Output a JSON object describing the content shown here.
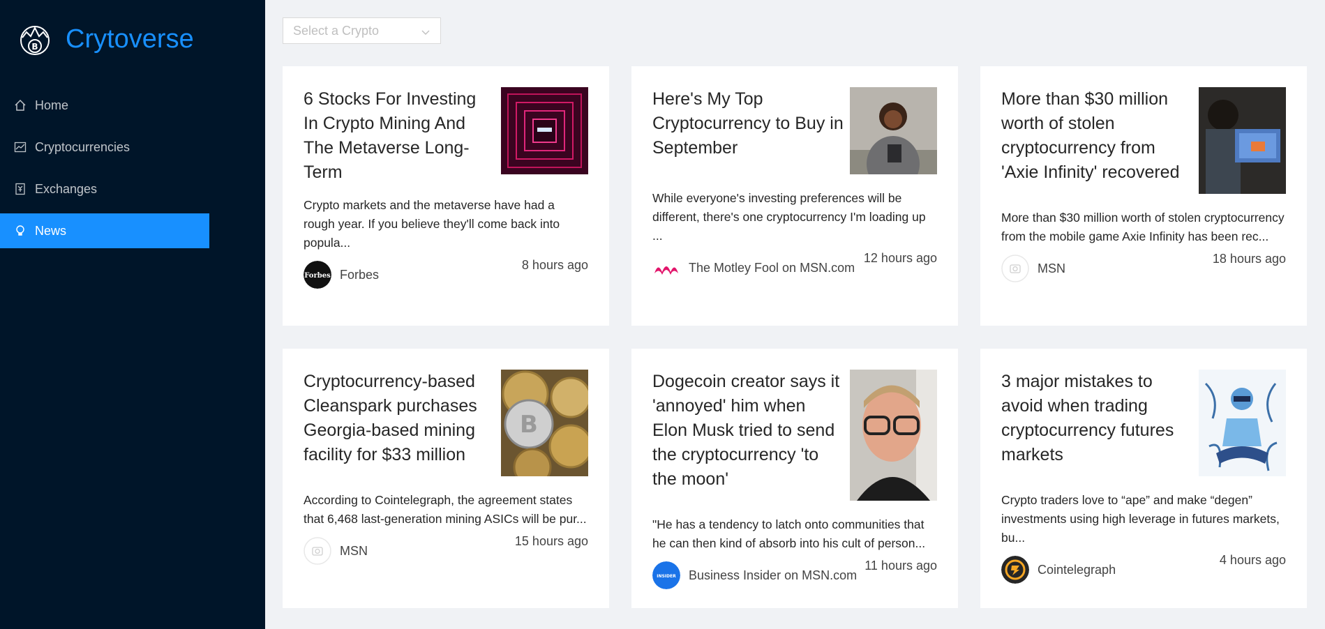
{
  "app": {
    "name": "Crytoverse"
  },
  "colors": {
    "sidebar_bg": "#001529",
    "accent": "#1890ff",
    "page_bg": "#f0f2f5"
  },
  "menu": [
    {
      "label": "Home",
      "icon": "home-icon"
    },
    {
      "label": "Cryptocurrencies",
      "icon": "fund-icon"
    },
    {
      "label": "Exchanges",
      "icon": "money-collect-icon"
    },
    {
      "label": "News",
      "icon": "bulb-icon",
      "active": true
    }
  ],
  "select": {
    "placeholder": "Select a Crypto"
  },
  "news": [
    {
      "title": "6 Stocks For Investing In Crypto Mining And The Metaverse Long-Term",
      "description": "Crypto markets and the metaverse have had a rough year. If you believe they'll come back into popula...",
      "provider": "Forbes",
      "time": "8 hours ago",
      "thumb": "neon-tunnel-image",
      "avatar": "forbes-logo"
    },
    {
      "title": "Here's My Top Cryptocurrency to Buy in September",
      "description": "While everyone's investing preferences will be different, there's one cryptocurrency I'm loading up ...",
      "provider": "The Motley Fool on MSN.com",
      "time": "12 hours ago",
      "thumb": "woman-with-tablet-image",
      "avatar": "motley-fool-logo"
    },
    {
      "title": "More than $30 million worth of stolen cryptocurrency from 'Axie Infinity' recovered",
      "description": "More than $30 million worth of stolen cryptocurrency from the mobile game Axie Infinity has been rec...",
      "provider": "MSN",
      "time": "18 hours ago",
      "thumb": "person-playing-game-image",
      "avatar": "camera-placeholder"
    },
    {
      "title": "Cryptocurrency-based Cleanspark purchases Georgia-based mining facility for $33 million",
      "description": "According to Cointelegraph, the agreement states that 6,468 last-generation mining ASICs will be pur...",
      "provider": "MSN",
      "time": "15 hours ago",
      "thumb": "bitcoin-coins-image",
      "avatar": "camera-placeholder"
    },
    {
      "title": "Dogecoin creator says it 'annoyed' him when Elon Musk tried to send the cryptocurrency 'to the moon'",
      "description": "\"He has a tendency to latch onto communities that he can then kind of absorb into his cult of person...",
      "provider": "Business Insider on MSN.com",
      "time": "11 hours ago",
      "thumb": "man-with-glasses-image",
      "avatar": "insider-logo"
    },
    {
      "title": "3 major mistakes to avoid when trading cryptocurrency futures markets",
      "description": "Crypto traders love to “ape” and make “degen” investments using high leverage in futures markets, bu...",
      "provider": "Cointelegraph",
      "time": "4 hours ago",
      "thumb": "meditating-man-illustration",
      "avatar": "cointelegraph-logo"
    }
  ]
}
